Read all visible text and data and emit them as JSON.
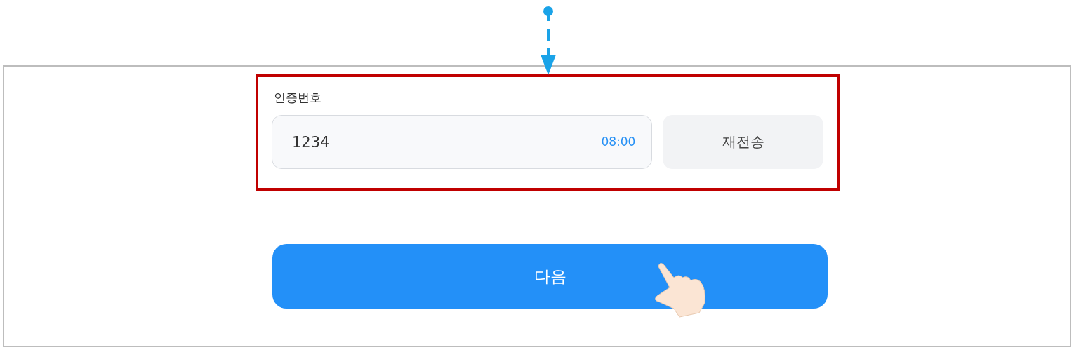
{
  "verification": {
    "label": "인증번호",
    "code": {
      "value": "1234"
    },
    "timer": "08:00",
    "resend_button": "재전송"
  },
  "next_button": "다음"
}
